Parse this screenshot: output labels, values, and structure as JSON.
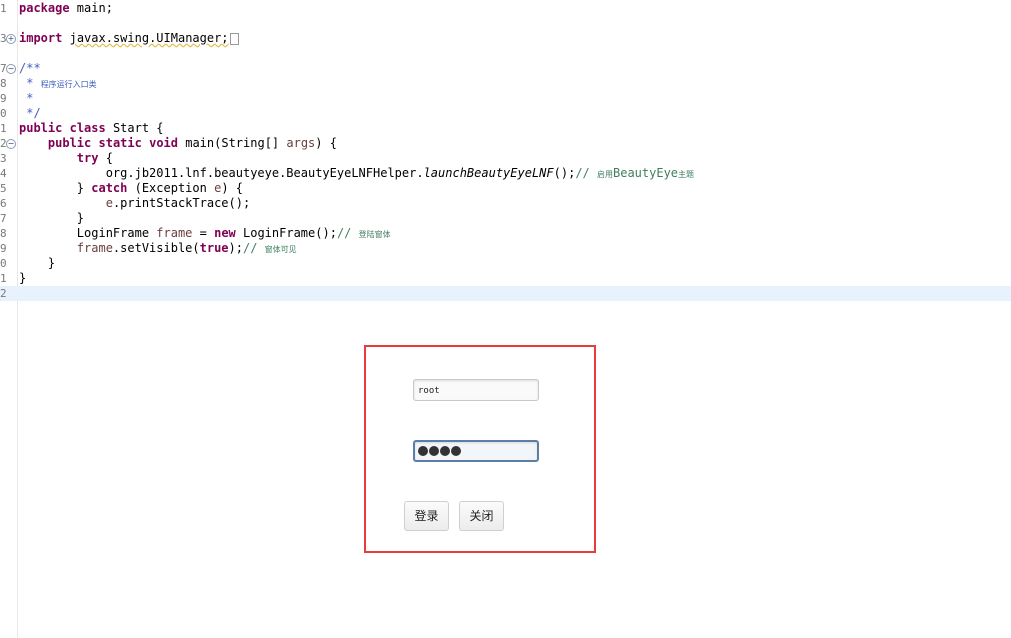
{
  "editor": {
    "lines": [
      {
        "no": "1",
        "fold": "",
        "parts": [
          {
            "t": "package",
            "c": "kw"
          },
          {
            "t": " main;"
          }
        ]
      },
      {
        "no": "",
        "fold": "",
        "parts": []
      },
      {
        "no": "3",
        "fold": "+",
        "parts": [
          {
            "t": "import",
            "c": "kw"
          },
          {
            "t": " "
          },
          {
            "t": "javax.swing.UIManager;",
            "c": "warn"
          }
        ],
        "collapsed": true
      },
      {
        "no": "",
        "fold": "",
        "parts": []
      },
      {
        "no": "7",
        "fold": "-",
        "parts": [
          {
            "t": "/**",
            "c": "cm-doc"
          }
        ]
      },
      {
        "no": "8",
        "fold": "",
        "parts": [
          {
            "t": " * ",
            "c": "cm-doc"
          },
          {
            "t": "程序运行入口类",
            "c": "cm-doc cjk"
          }
        ]
      },
      {
        "no": "9",
        "fold": "",
        "parts": [
          {
            "t": " *",
            "c": "cm-doc"
          }
        ]
      },
      {
        "no": "0",
        "fold": "",
        "parts": [
          {
            "t": " */",
            "c": "cm-doc"
          }
        ]
      },
      {
        "no": "1",
        "fold": "",
        "parts": [
          {
            "t": "public",
            "c": "kw"
          },
          {
            "t": " "
          },
          {
            "t": "class",
            "c": "kw"
          },
          {
            "t": " Start {"
          }
        ]
      },
      {
        "no": "2",
        "fold": "-",
        "parts": [
          {
            "t": "    "
          },
          {
            "t": "public",
            "c": "kw"
          },
          {
            "t": " "
          },
          {
            "t": "static",
            "c": "kw"
          },
          {
            "t": " "
          },
          {
            "t": "void",
            "c": "kw"
          },
          {
            "t": " main(String[] "
          },
          {
            "t": "args",
            "c": "var"
          },
          {
            "t": ") {"
          }
        ]
      },
      {
        "no": "3",
        "fold": "",
        "parts": [
          {
            "t": "        "
          },
          {
            "t": "try",
            "c": "kw"
          },
          {
            "t": " {"
          }
        ]
      },
      {
        "no": "4",
        "fold": "",
        "parts": [
          {
            "t": "            org.jb2011.lnf.beautyeye.BeautyEyeLNFHelper."
          },
          {
            "t": "launchBeautyEyeLNF",
            "c": "it"
          },
          {
            "t": "();"
          },
          {
            "t": "// ",
            "c": "cm"
          },
          {
            "t": "启用",
            "c": "cm cjk"
          },
          {
            "t": "BeautyEye",
            "c": "cm"
          },
          {
            "t": "主题",
            "c": "cm cjk"
          }
        ]
      },
      {
        "no": "5",
        "fold": "",
        "parts": [
          {
            "t": "        } "
          },
          {
            "t": "catch",
            "c": "kw"
          },
          {
            "t": " (Exception "
          },
          {
            "t": "e",
            "c": "var"
          },
          {
            "t": ") {"
          }
        ]
      },
      {
        "no": "6",
        "fold": "",
        "parts": [
          {
            "t": "            "
          },
          {
            "t": "e",
            "c": "var"
          },
          {
            "t": ".printStackTrace();"
          }
        ]
      },
      {
        "no": "7",
        "fold": "",
        "parts": [
          {
            "t": "        }"
          }
        ]
      },
      {
        "no": "8",
        "fold": "",
        "parts": [
          {
            "t": "        LoginFrame "
          },
          {
            "t": "frame",
            "c": "var"
          },
          {
            "t": " = "
          },
          {
            "t": "new",
            "c": "kw"
          },
          {
            "t": " LoginFrame();"
          },
          {
            "t": "// ",
            "c": "cm"
          },
          {
            "t": "登陆窗体",
            "c": "cm cjk"
          }
        ]
      },
      {
        "no": "9",
        "fold": "",
        "parts": [
          {
            "t": "        "
          },
          {
            "t": "frame",
            "c": "var"
          },
          {
            "t": ".setVisible("
          },
          {
            "t": "true",
            "c": "kw"
          },
          {
            "t": ");"
          },
          {
            "t": "// ",
            "c": "cm"
          },
          {
            "t": "窗体可见",
            "c": "cm cjk"
          }
        ]
      },
      {
        "no": "0",
        "fold": "",
        "parts": [
          {
            "t": "    }"
          }
        ]
      },
      {
        "no": "1",
        "fold": "",
        "parts": [
          {
            "t": "}"
          }
        ]
      },
      {
        "no": "2",
        "fold": "",
        "parts": [],
        "current": true
      }
    ]
  },
  "login_window": {
    "username_value": "root",
    "password_masked_count": 4,
    "login_button": "登录",
    "close_button": "关闭"
  },
  "colors": {
    "highlight_border": "#e53c3c",
    "keyword": "#7f0055",
    "comment": "#3f7f5f",
    "doc_comment": "#3f5fbf"
  }
}
